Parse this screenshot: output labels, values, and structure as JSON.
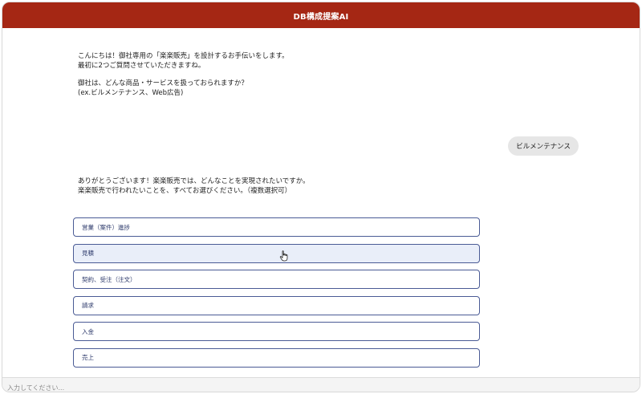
{
  "header": {
    "title": "DB構成提案AI"
  },
  "messages": {
    "bot1": {
      "line1": "こんにちは！御社専用の「楽楽販売」を設計するお手伝いをします。",
      "line2": "最初に2つご質問させていただきますね。",
      "line3": "御社は、どんな商品・サービスを扱っておられますか？",
      "line4": "(ex.ビルメンテナンス、Web広告)"
    },
    "user1": "ビルメンテナンス",
    "bot2": {
      "line1": "ありがとうございます！楽楽販売では、どんなことを実現されたいですか。",
      "line2": "楽楽販売で行われたいことを、すべてお選びください。（複数選択可）"
    }
  },
  "options": [
    {
      "label": "営業（案件）進捗"
    },
    {
      "label": "見積"
    },
    {
      "label": "契約、受注（注文）"
    },
    {
      "label": "請求"
    },
    {
      "label": "入金"
    },
    {
      "label": "売上"
    }
  ],
  "input": {
    "placeholder": "入力してください..."
  },
  "colors": {
    "header_bg": "#a52714",
    "option_border": "#4a5b95",
    "option_hover_bg": "#e9eef9",
    "user_bubble_bg": "#e6e6e6"
  }
}
